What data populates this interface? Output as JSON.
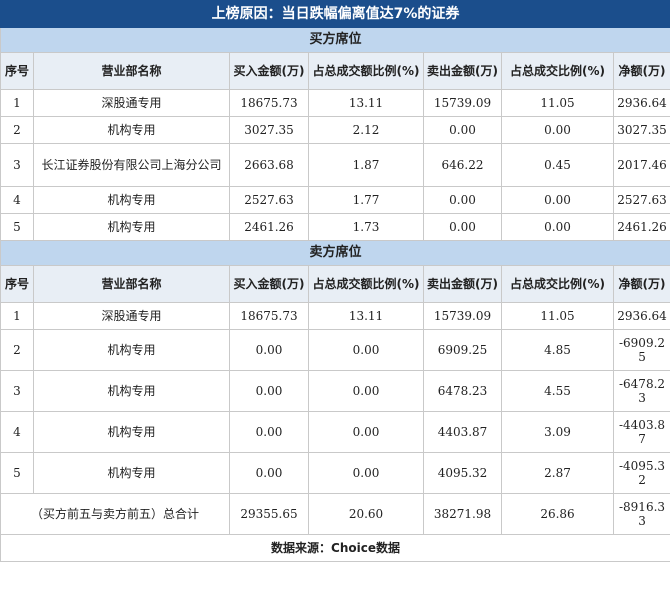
{
  "title": "上榜原因：当日跌幅偏离值达7%的证券",
  "buy": {
    "section_label": "买方席位",
    "headers": [
      "序号",
      "营业部名称",
      "买入金额(万)",
      "占总成交额比例(%)",
      "卖出金额(万)",
      "占总成交比例(%)",
      "净额(万)"
    ],
    "rows": [
      [
        "1",
        "深股通专用",
        "18675.73",
        "13.11",
        "15739.09",
        "11.05",
        "2936.64"
      ],
      [
        "2",
        "机构专用",
        "3027.35",
        "2.12",
        "0.00",
        "0.00",
        "3027.35"
      ],
      [
        "3",
        "长江证券股份有限公司上海分公司",
        "2663.68",
        "1.87",
        "646.22",
        "0.45",
        "2017.46"
      ],
      [
        "4",
        "机构专用",
        "2527.63",
        "1.77",
        "0.00",
        "0.00",
        "2527.63"
      ],
      [
        "5",
        "机构专用",
        "2461.26",
        "1.73",
        "0.00",
        "0.00",
        "2461.26"
      ]
    ]
  },
  "sell": {
    "section_label": "卖方席位",
    "headers": [
      "序号",
      "营业部名称",
      "买入金额(万)",
      "占总成交额比例(%)",
      "卖出金额(万)",
      "占总成交比例(%)",
      "净额(万)"
    ],
    "rows": [
      [
        "1",
        "深股通专用",
        "18675.73",
        "13.11",
        "15739.09",
        "11.05",
        "2936.64"
      ],
      [
        "2",
        "机构专用",
        "0.00",
        "0.00",
        "6909.25",
        "4.85",
        "-6909.25"
      ],
      [
        "3",
        "机构专用",
        "0.00",
        "0.00",
        "6478.23",
        "4.55",
        "-6478.23"
      ],
      [
        "4",
        "机构专用",
        "0.00",
        "0.00",
        "4403.87",
        "3.09",
        "-4403.87"
      ],
      [
        "5",
        "机构专用",
        "0.00",
        "0.00",
        "4095.32",
        "2.87",
        "-4095.32"
      ]
    ]
  },
  "total": [
    "（买方前五与卖方前五）总合计",
    "29355.65",
    "20.60",
    "38271.98",
    "26.86",
    "-8916.33"
  ],
  "footer": "数据来源：Choice数据"
}
